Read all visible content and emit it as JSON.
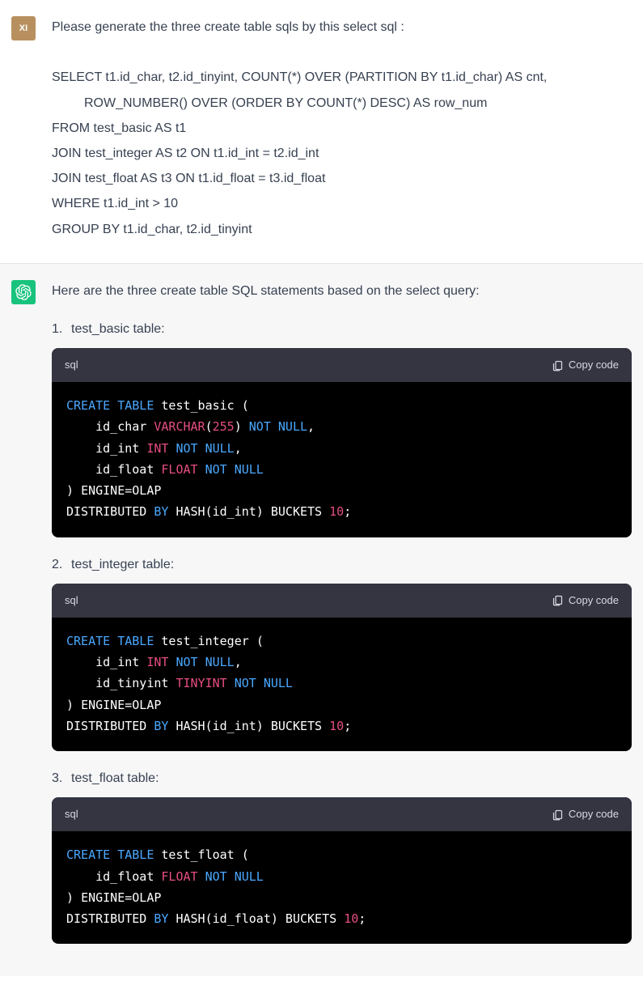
{
  "user": {
    "avatar_label": "XI",
    "prompt_intro": "Please generate the three create table sqls by this select sql :",
    "sql_l1": "SELECT t1.id_char, t2.id_tinyint, COUNT(*) OVER (PARTITION BY t1.id_char) AS cnt,",
    "sql_l2": "ROW_NUMBER() OVER (ORDER BY COUNT(*) DESC) AS row_num",
    "sql_l3": "FROM test_basic AS t1",
    "sql_l4": "JOIN test_integer AS t2 ON t1.id_int = t2.id_int",
    "sql_l5": "JOIN test_float AS t3 ON t1.id_float = t3.id_float",
    "sql_l6": "WHERE t1.id_int > 10",
    "sql_l7": "GROUP BY t1.id_char, t2.id_tinyint"
  },
  "assistant": {
    "intro": "Here are the three create table SQL statements based on the select query:",
    "items": [
      {
        "num": "1.",
        "label": "test_basic table:"
      },
      {
        "num": "2.",
        "label": "test_integer table:"
      },
      {
        "num": "3.",
        "label": "test_float table:"
      }
    ],
    "code_lang": "sql",
    "copy_label": "Copy code",
    "code1": {
      "l1_kw": "CREATE TABLE",
      "l1_id": " test_basic ",
      "l1_p": "(",
      "l2_id": "    id_char ",
      "l2_ty": "VARCHAR",
      "l2_p1": "(",
      "l2_n": "255",
      "l2_p2": ") ",
      "l2_kw": "NOT NULL",
      "l2_end": ",",
      "l3_id": "    id_int ",
      "l3_ty": "INT ",
      "l3_kw": "NOT NULL",
      "l3_end": ",",
      "l4_id": "    id_float ",
      "l4_ty": "FLOAT ",
      "l4_kw": "NOT NULL",
      "l5_p": ") ",
      "l5_id": "ENGINE=OLAP",
      "l6_a": "DISTRIBUTED ",
      "l6_kw": "BY",
      "l6_b": " HASH(id_int) BUCKETS ",
      "l6_n": "10",
      "l6_end": ";"
    },
    "code2": {
      "l1_kw": "CREATE TABLE",
      "l1_id": " test_integer ",
      "l1_p": "(",
      "l2_id": "    id_int ",
      "l2_ty": "INT ",
      "l2_kw": "NOT NULL",
      "l2_end": ",",
      "l3_id": "    id_tinyint ",
      "l3_ty": "TINYINT ",
      "l3_kw": "NOT NULL",
      "l4_p": ") ",
      "l4_id": "ENGINE=OLAP",
      "l5_a": "DISTRIBUTED ",
      "l5_kw": "BY",
      "l5_b": " HASH(id_int) BUCKETS ",
      "l5_n": "10",
      "l5_end": ";"
    },
    "code3": {
      "l1_kw": "CREATE TABLE",
      "l1_id": " test_float ",
      "l1_p": "(",
      "l2_id": "    id_float ",
      "l2_ty": "FLOAT ",
      "l2_kw": "NOT NULL",
      "l3_p": ") ",
      "l3_id": "ENGINE=OLAP",
      "l4_a": "DISTRIBUTED ",
      "l4_kw": "BY",
      "l4_b": " HASH(id_float) BUCKETS ",
      "l4_n": "10",
      "l4_end": ";"
    }
  }
}
